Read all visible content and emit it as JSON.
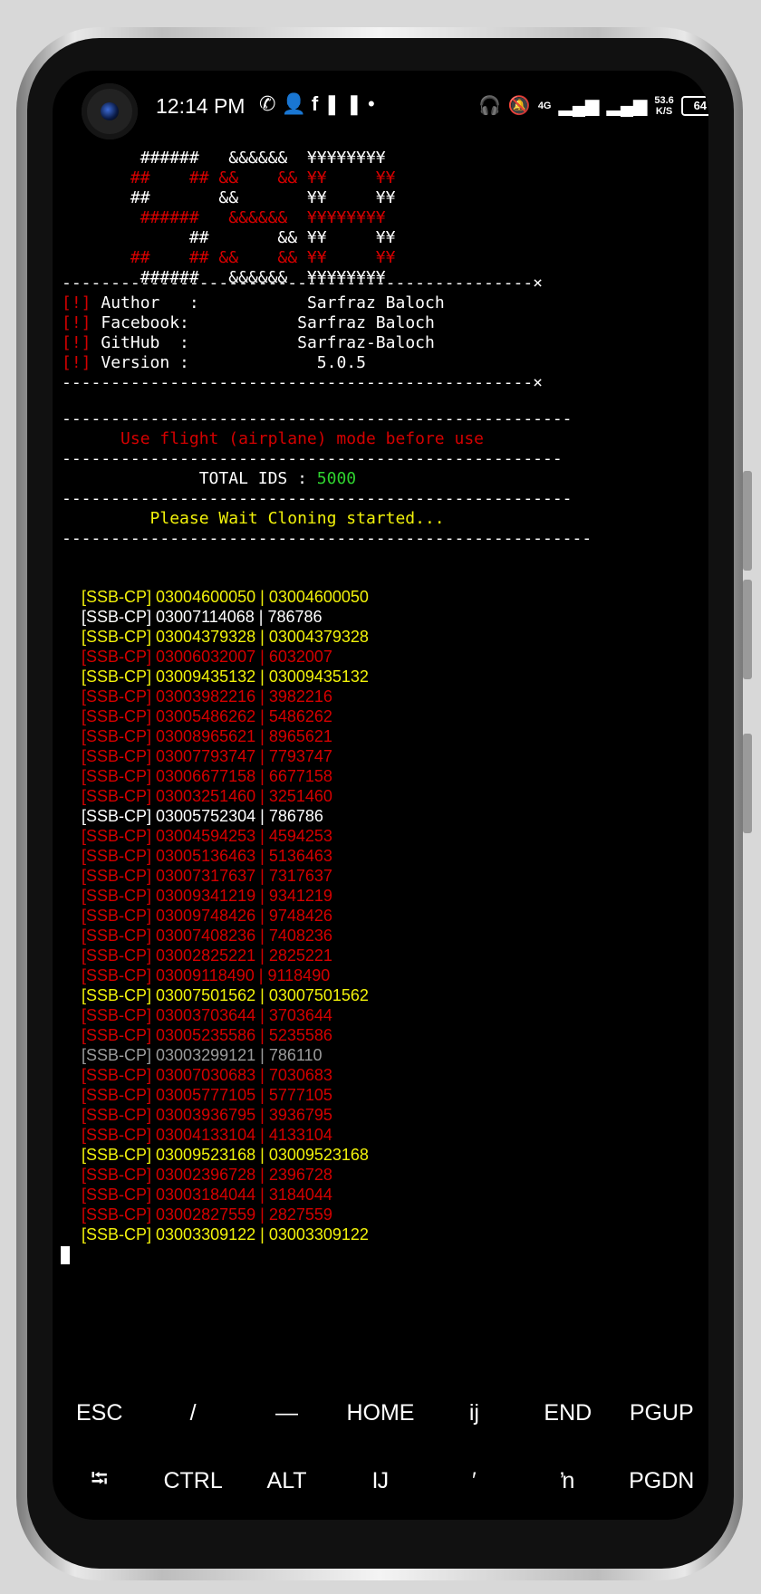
{
  "status_bar": {
    "time": "12:14 PM",
    "notif_icons": [
      "whatsapp-icon",
      "add-person-icon",
      "facebook-icon",
      "pause-icon",
      "dot-icon"
    ],
    "net_speed_value": "53.6",
    "net_speed_unit": "K/S",
    "network_label": "4G",
    "battery": "64"
  },
  "banner": {
    "lines": [
      {
        "text": "        ######   &&&&&&  ¥¥¥¥¥¥¥¥",
        "color": "#ffffff"
      },
      {
        "text": "       ##    ## &&    && ¥¥     ¥¥",
        "color": "#d40000"
      },
      {
        "text": "       ##       &&       ¥¥     ¥¥",
        "color": "#ffffff"
      },
      {
        "text": "        ######   &&&&&&  ¥¥¥¥¥¥¥¥",
        "color": "#d40000"
      },
      {
        "text": "             ##       && ¥¥     ¥¥",
        "color": "#ffffff"
      },
      {
        "text": "       ##    ## &&    && ¥¥     ¥¥",
        "color": "#d40000"
      },
      {
        "text": "        ######   &&&&&&  ¥¥¥¥¥¥¥¥",
        "color": "#ffffff"
      }
    ]
  },
  "info": {
    "separator": "------------------------------------------------×",
    "items": [
      {
        "tag": "[!]",
        "label": "Author   :",
        "value": "           Sarfraz Baloch"
      },
      {
        "tag": "[!]",
        "label": "Facebook:",
        "value": "           Sarfraz Baloch"
      },
      {
        "tag": "[!]",
        "label": "GitHub  :",
        "value": "           Sarfraz-Baloch"
      },
      {
        "tag": "[!]",
        "label": "Version :",
        "value": "             5.0.5"
      }
    ]
  },
  "notice": {
    "sep_long": "----------------------------------------------------",
    "text": "      Use flight (airplane) mode before use",
    "sep_mid": "---------------------------------------------------",
    "total_label": "              TOTAL IDS : ",
    "total_value": "5000",
    "sep_short": "----------------------------------------------------",
    "wait_text": "         Please Wait Cloning started...",
    "sep_wait": "------------------------------------------------------"
  },
  "results": [
    {
      "text": "[SSB-CP] 03004600050 | 03004600050",
      "color": "#f2f20a"
    },
    {
      "text": "[SSB-CP] 03007114068 | 786786",
      "color": "#ffffff"
    },
    {
      "text": "[SSB-CP] 03004379328 | 03004379328",
      "color": "#f2f20a"
    },
    {
      "text": "[SSB-CP] 03006032007 | 6032007",
      "color": "#d40000"
    },
    {
      "text": "[SSB-CP] 03009435132 | 03009435132",
      "color": "#f2f20a"
    },
    {
      "text": "[SSB-CP] 03003982216 | 3982216",
      "color": "#d40000"
    },
    {
      "text": "[SSB-CP] 03005486262 | 5486262",
      "color": "#d40000"
    },
    {
      "text": "[SSB-CP] 03008965621 | 8965621",
      "color": "#d40000"
    },
    {
      "text": "[SSB-CP] 03007793747 | 7793747",
      "color": "#d40000"
    },
    {
      "text": "[SSB-CP] 03006677158 | 6677158",
      "color": "#d40000"
    },
    {
      "text": "[SSB-CP] 03003251460 | 3251460",
      "color": "#d40000"
    },
    {
      "text": "[SSB-CP] 03005752304 | 786786",
      "color": "#ffffff"
    },
    {
      "text": "[SSB-CP] 03004594253 | 4594253",
      "color": "#d40000"
    },
    {
      "text": "[SSB-CP] 03005136463 | 5136463",
      "color": "#d40000"
    },
    {
      "text": "[SSB-CP] 03007317637 | 7317637",
      "color": "#d40000"
    },
    {
      "text": "[SSB-CP] 03009341219 | 9341219",
      "color": "#d40000"
    },
    {
      "text": "[SSB-CP] 03009748426 | 9748426",
      "color": "#d40000"
    },
    {
      "text": "[SSB-CP] 03007408236 | 7408236",
      "color": "#d40000"
    },
    {
      "text": "[SSB-CP] 03002825221 | 2825221",
      "color": "#d40000"
    },
    {
      "text": "[SSB-CP] 03009118490 | 9118490",
      "color": "#d40000"
    },
    {
      "text": "[SSB-CP] 03007501562 | 03007501562",
      "color": "#f2f20a"
    },
    {
      "text": "[SSB-CP] 03003703644 | 3703644",
      "color": "#d40000"
    },
    {
      "text": "[SSB-CP] 03005235586 | 5235586",
      "color": "#d40000"
    },
    {
      "text": "[SSB-CP] 03003299121 | 786110",
      "color": "#9b9b9b"
    },
    {
      "text": "[SSB-CP] 03007030683 | 7030683",
      "color": "#d40000"
    },
    {
      "text": "[SSB-CP] 03005777105 | 5777105",
      "color": "#d40000"
    },
    {
      "text": "[SSB-CP] 03003936795 | 3936795",
      "color": "#d40000"
    },
    {
      "text": "[SSB-CP] 03004133104 | 4133104",
      "color": "#d40000"
    },
    {
      "text": "[SSB-CP] 03009523168 | 03009523168",
      "color": "#f2f20a"
    },
    {
      "text": "[SSB-CP] 03002396728 | 2396728",
      "color": "#d40000"
    },
    {
      "text": "[SSB-CP] 03003184044 | 3184044",
      "color": "#d40000"
    },
    {
      "text": "[SSB-CP] 03002827559 | 2827559",
      "color": "#d40000"
    },
    {
      "text": "[SSB-CP] 03003309122 | 03003309122",
      "color": "#f2f20a"
    }
  ],
  "extra_keys": {
    "row1": [
      "ESC",
      "/",
      "—",
      "HOME",
      "ij",
      "END",
      "PGUP"
    ],
    "row2": [
      "⭾",
      "CTRL",
      "ALT",
      "Ĳ",
      "′",
      "ŉ",
      "PGDN"
    ]
  }
}
